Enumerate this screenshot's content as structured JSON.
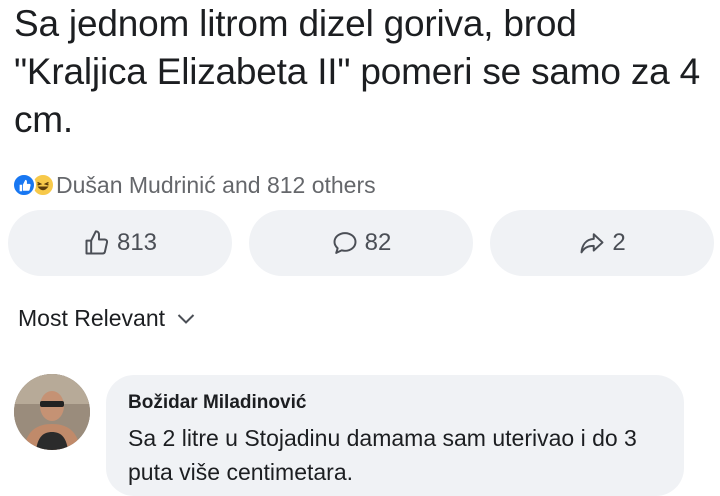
{
  "post": {
    "text": "Sa jednom litrom dizel goriva, brod \"Kraljica Elizabeta II\" pomeri se samo za 4 cm."
  },
  "reactions": {
    "summary": "Dušan Mudrinić and 812 others",
    "icons": [
      "like-icon",
      "haha-icon"
    ]
  },
  "actions": {
    "like_count": "813",
    "comment_count": "82",
    "share_count": "2"
  },
  "sort": {
    "label": "Most Relevant"
  },
  "comment": {
    "author": "Božidar Miladinović",
    "text": "Sa 2 litre u Stojadinu damama sam uterivao i do 3 puta više centimetara."
  },
  "colors": {
    "like_blue": "#1877f2",
    "haha_yellow": "#f7c94a",
    "bubble_bg": "#f0f2f5",
    "muted_text": "#65676b"
  }
}
